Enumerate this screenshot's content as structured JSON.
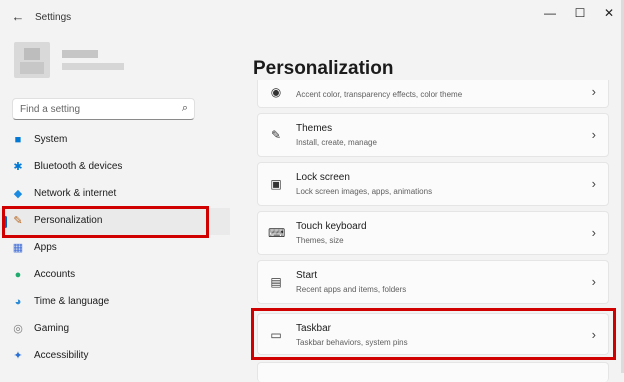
{
  "window": {
    "title": "Settings",
    "back_icon": "←",
    "minimize": "—",
    "maximize": "☐",
    "close": "✕"
  },
  "search": {
    "placeholder": "Find a setting",
    "icon": "⌕"
  },
  "nav": [
    {
      "label": "System",
      "icon": "■",
      "color": "#0078d4"
    },
    {
      "label": "Bluetooth & devices",
      "icon": "✱",
      "color": "#0078d4"
    },
    {
      "label": "Network & internet",
      "icon": "◆",
      "color": "#1a8be0"
    },
    {
      "label": "Personalization",
      "icon": "✎",
      "color": "#b5651d",
      "selected": true
    },
    {
      "label": "Apps",
      "icon": "▦",
      "color": "#3d6bd6"
    },
    {
      "label": "Accounts",
      "icon": "●",
      "color": "#1faa6e"
    },
    {
      "label": "Time & language",
      "icon": "◕",
      "color": "#2a8bd6"
    },
    {
      "label": "Gaming",
      "icon": "◎",
      "color": "#7a7a7a"
    },
    {
      "label": "Accessibility",
      "icon": "✦",
      "color": "#2a6fd6"
    }
  ],
  "main": {
    "title": "Personalization",
    "cards": [
      {
        "title": "",
        "subtitle": "Accent color, transparency effects, color theme",
        "icon": "◉"
      },
      {
        "title": "Themes",
        "subtitle": "Install, create, manage",
        "icon": "✎"
      },
      {
        "title": "Lock screen",
        "subtitle": "Lock screen images, apps, animations",
        "icon": "▣"
      },
      {
        "title": "Touch keyboard",
        "subtitle": "Themes, size",
        "icon": "⌨"
      },
      {
        "title": "Start",
        "subtitle": "Recent apps and items, folders",
        "icon": "▤"
      },
      {
        "title": "Taskbar",
        "subtitle": "Taskbar behaviors, system pins",
        "icon": "▭"
      }
    ],
    "chevron": "›"
  },
  "colors": {
    "highlight": "#d10000",
    "accent": "#0067c0"
  }
}
